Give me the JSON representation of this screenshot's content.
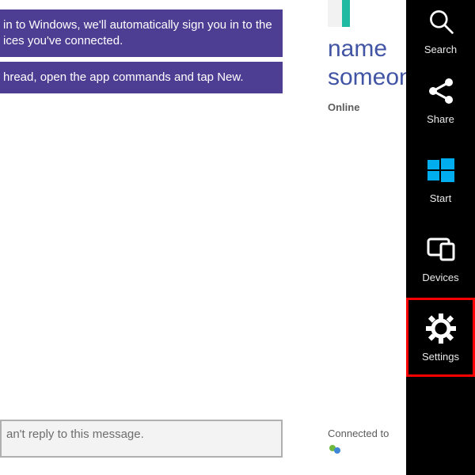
{
  "chat": {
    "bubble1_line1": "in to Windows, we'll automatically sign you in to the",
    "bubble1_line2": "ices you've connected.",
    "bubble2": "hread, open the app commands and tap New.",
    "input_placeholder": "an't reply to this message."
  },
  "contact": {
    "name_line1": "name",
    "name_line2": "someone",
    "status": "Online",
    "connected_label": "Connected to"
  },
  "charms": {
    "search": "Search",
    "share": "Share",
    "start": "Start",
    "devices": "Devices",
    "settings": "Settings"
  }
}
